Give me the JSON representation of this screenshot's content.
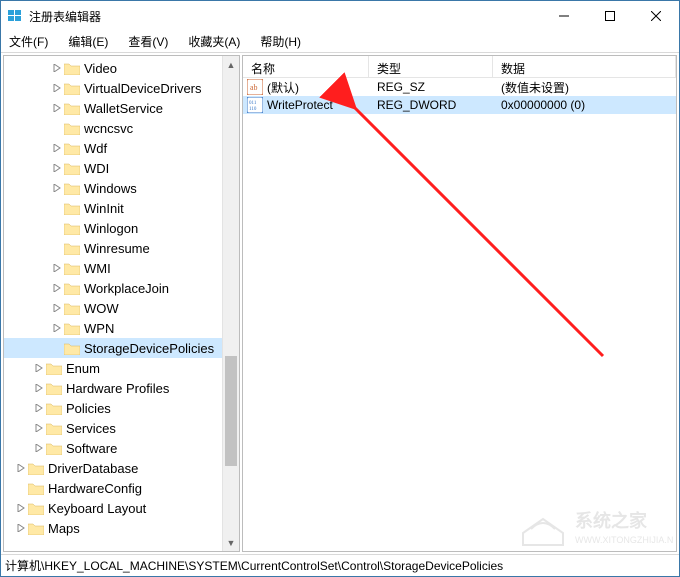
{
  "window": {
    "title": "注册表编辑器"
  },
  "menubar": {
    "file": "文件(F)",
    "edit": "编辑(E)",
    "view": "查看(V)",
    "favorites": "收藏夹(A)",
    "help": "帮助(H)"
  },
  "columns": {
    "name": "名称",
    "type": "类型",
    "data": "数据"
  },
  "tree": [
    {
      "indent": 2,
      "expander": "closed",
      "label": "Video"
    },
    {
      "indent": 2,
      "expander": "closed",
      "label": "VirtualDeviceDrivers"
    },
    {
      "indent": 2,
      "expander": "closed",
      "label": "WalletService"
    },
    {
      "indent": 2,
      "expander": "none",
      "label": "wcncsvc"
    },
    {
      "indent": 2,
      "expander": "closed",
      "label": "Wdf"
    },
    {
      "indent": 2,
      "expander": "closed",
      "label": "WDI"
    },
    {
      "indent": 2,
      "expander": "closed",
      "label": "Windows"
    },
    {
      "indent": 2,
      "expander": "none",
      "label": "WinInit"
    },
    {
      "indent": 2,
      "expander": "none",
      "label": "Winlogon"
    },
    {
      "indent": 2,
      "expander": "none",
      "label": "Winresume"
    },
    {
      "indent": 2,
      "expander": "closed",
      "label": "WMI"
    },
    {
      "indent": 2,
      "expander": "closed",
      "label": "WorkplaceJoin"
    },
    {
      "indent": 2,
      "expander": "closed",
      "label": "WOW"
    },
    {
      "indent": 2,
      "expander": "closed",
      "label": "WPN"
    },
    {
      "indent": 2,
      "expander": "none",
      "label": "StorageDevicePolicies",
      "selected": true
    },
    {
      "indent": 1,
      "expander": "closed",
      "label": "Enum"
    },
    {
      "indent": 1,
      "expander": "closed",
      "label": "Hardware Profiles"
    },
    {
      "indent": 1,
      "expander": "closed",
      "label": "Policies"
    },
    {
      "indent": 1,
      "expander": "closed",
      "label": "Services"
    },
    {
      "indent": 1,
      "expander": "closed",
      "label": "Software"
    },
    {
      "indent": 0,
      "expander": "closed",
      "label": "DriverDatabase"
    },
    {
      "indent": 0,
      "expander": "none",
      "label": "HardwareConfig"
    },
    {
      "indent": 0,
      "expander": "closed",
      "label": "Keyboard Layout"
    },
    {
      "indent": 0,
      "expander": "closed",
      "label": "Maps"
    }
  ],
  "values": [
    {
      "icon": "string",
      "name": "(默认)",
      "type": "REG_SZ",
      "data": "(数值未设置)",
      "selected": false
    },
    {
      "icon": "binary",
      "name": "WriteProtect",
      "type": "REG_DWORD",
      "data": "0x00000000 (0)",
      "selected": true
    }
  ],
  "statusbar": {
    "path": "计算机\\HKEY_LOCAL_MACHINE\\SYSTEM\\CurrentControlSet\\Control\\StorageDevicePolicies"
  },
  "watermark": {
    "brand": "系统之家",
    "url": "WWW.XITONGZHIJIA.NET"
  }
}
